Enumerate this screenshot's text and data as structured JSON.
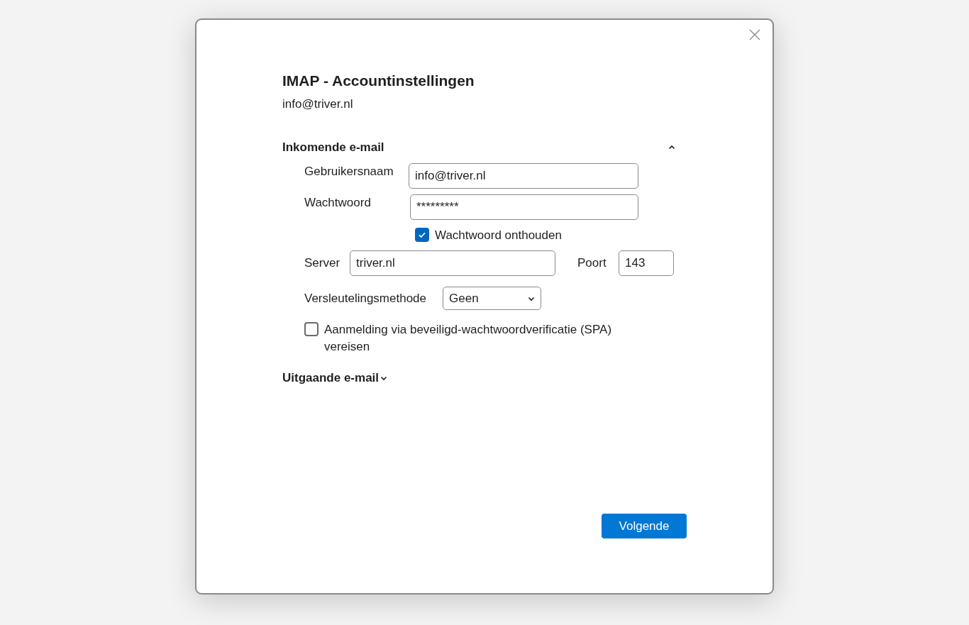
{
  "dialog": {
    "title": "IMAP - Accountinstellingen",
    "subtitle": "info@triver.nl"
  },
  "incoming": {
    "title": "Inkomende e-mail",
    "expanded": true,
    "username": {
      "label": "Gebruikersnaam",
      "value": "info@triver.nl"
    },
    "password": {
      "label": "Wachtwoord",
      "value": "*********"
    },
    "remember": {
      "label": "Wachtwoord onthouden",
      "checked": true
    },
    "server": {
      "label": "Server",
      "value": "triver.nl"
    },
    "port": {
      "label": "Poort",
      "value": "143"
    },
    "encryption": {
      "label": "Versleutelingsmethode",
      "value": "Geen"
    },
    "spa": {
      "label": "Aanmelding via beveiligd-wachtwoordverificatie (SPA) vereisen",
      "checked": false
    }
  },
  "outgoing": {
    "title": "Uitgaande e-mail",
    "expanded": false
  },
  "button": "Volgende"
}
